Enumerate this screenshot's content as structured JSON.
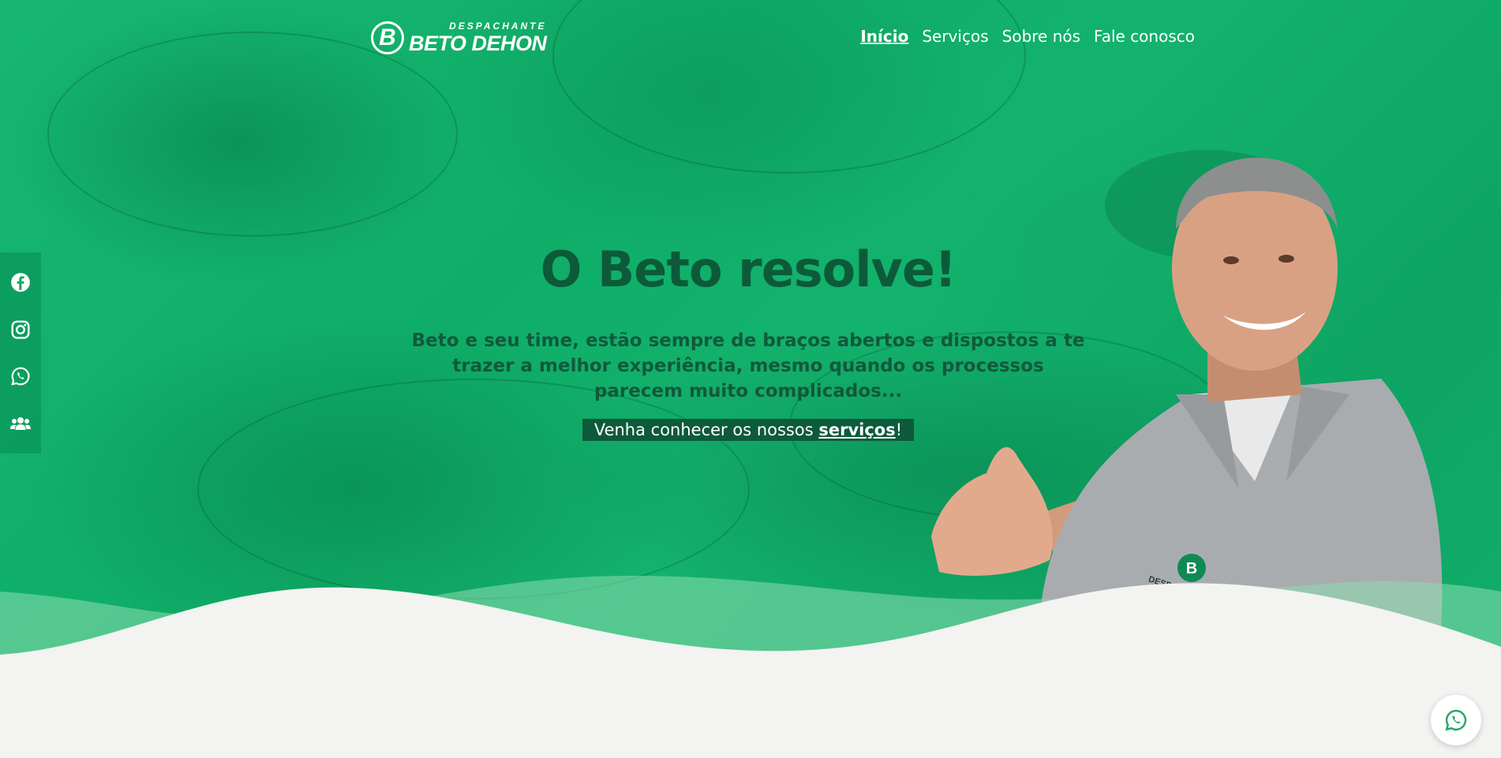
{
  "brand": {
    "logo_letter": "B",
    "logo_small": "DESPACHANTE",
    "logo_big": "BETO DEHON"
  },
  "nav": {
    "items": [
      "Início",
      "Serviços",
      "Sobre nós",
      "Fale conosco"
    ],
    "active": "Início"
  },
  "social": {
    "icons": [
      "facebook-icon",
      "instagram-icon",
      "whatsapp-icon",
      "users-icon"
    ]
  },
  "hero": {
    "title": "O Beto resolve!",
    "text": "Beto e seu time, estão sempre de braços abertos e dispostos a te trazer a melhor experiência, mesmo quando os processos parecem muito complicados...",
    "cta_prefix": "Venha conhecer os nossos ",
    "cta_link": "serviços",
    "cta_suffix": "!"
  },
  "shirt_logo": {
    "letter": "B",
    "text": "DESPACHANTE BETO"
  },
  "floating": {
    "icon": "whatsapp-icon"
  },
  "colors": {
    "hero_green": "#12ad6a",
    "dark_green": "#0d5a3c",
    "page_background": "#f3f3f1",
    "whatsapp_green": "#25a96a"
  }
}
